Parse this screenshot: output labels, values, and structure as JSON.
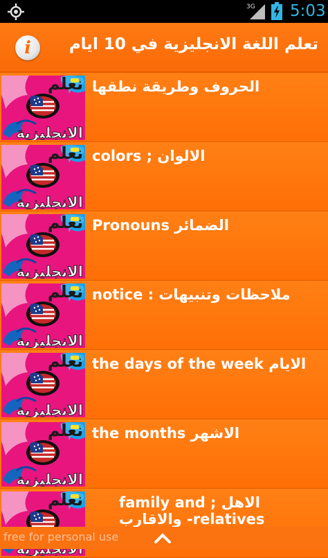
{
  "status_bar": {
    "network_label": "3G",
    "time": "5:03",
    "icons": [
      "gps-icon",
      "signal-icon",
      "battery-charging-icon"
    ],
    "accent_color": "#33b5e5"
  },
  "action_bar": {
    "title": "تعلم اللغة الانجليزية في 10 ايام",
    "info_icon": "info-icon",
    "background_color": "#ff7a14"
  },
  "thumbnail": {
    "top_text": "نعلم",
    "bottom_text": "الانجليزية"
  },
  "items": [
    {
      "label": "الحروف وطريقة نطقها"
    },
    {
      "label": "colors ; الالوان"
    },
    {
      "label": " Pronouns الضمائر"
    },
    {
      "label": "notice : ملاحظات وتنبيهات"
    },
    {
      "label": "the days of the week الايام"
    },
    {
      "label": "the months الاشهر"
    },
    {
      "label": "family and ; الاهل والاقارب -relatives"
    }
  ],
  "footer": {
    "watermark": "free for personal use",
    "scroll_icon": "chevron-up-icon"
  }
}
